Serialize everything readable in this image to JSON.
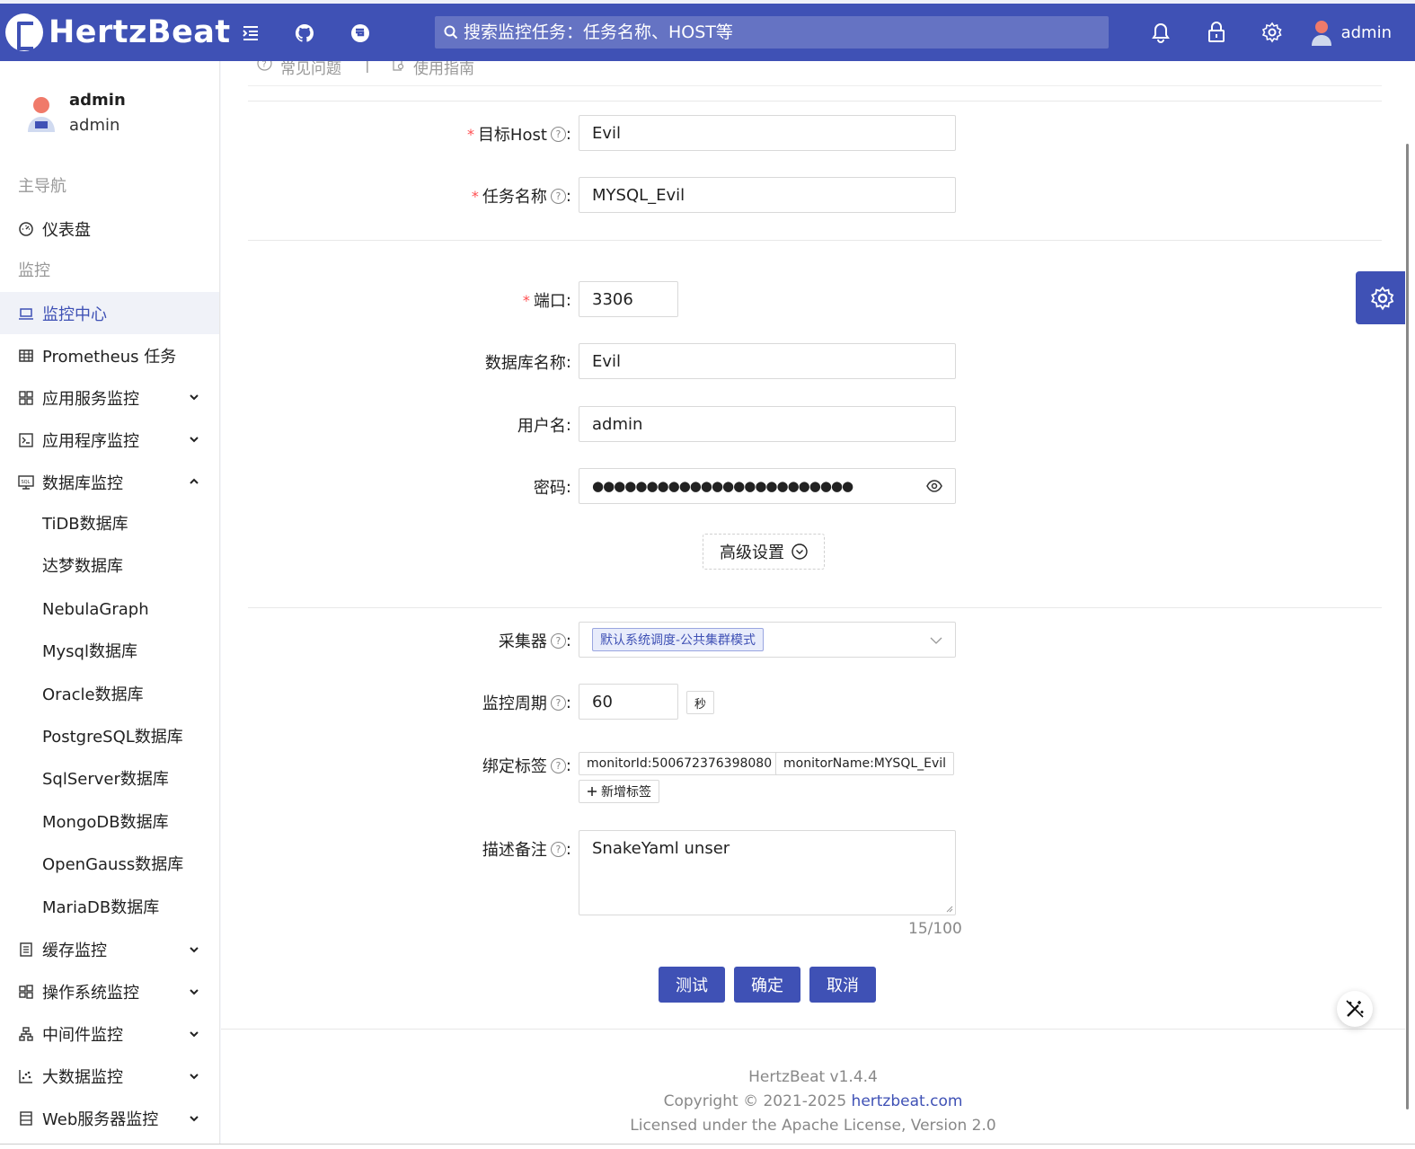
{
  "header": {
    "app_name": "HertzBeat",
    "search_placeholder": "搜索监控任务：任务名称、HOST等",
    "user": "admin"
  },
  "sidebar": {
    "user_name": "admin",
    "user_role": "admin",
    "group_main": "主导航",
    "dashboard": "仪表盘",
    "group_monitor": "监控",
    "monitor_center": "监控中心",
    "prometheus": "Prometheus 任务",
    "app_service": "应用服务监控",
    "app_program": "应用程序监控",
    "db_monitor": "数据库监控",
    "db_items": [
      "TiDB数据库",
      "达梦数据库",
      "NebulaGraph",
      "Mysql数据库",
      "Oracle数据库",
      "PostgreSQL数据库",
      "SqlServer数据库",
      "MongoDB数据库",
      "OpenGauss数据库",
      "MariaDB数据库"
    ],
    "cache": "缓存监控",
    "os": "操作系统监控",
    "middleware": "中间件监控",
    "bigdata": "大数据监控",
    "web": "Web服务器监控"
  },
  "crumb": {
    "faq": "常见问题",
    "sep": "|",
    "guide": "使用指南"
  },
  "form": {
    "host_label": "目标Host",
    "host_value": "Evil",
    "name_label": "任务名称",
    "name_value": "MYSQL_Evil",
    "port_label": "端口",
    "port_value": "3306",
    "db_label": "数据库名称",
    "db_value": "Evil",
    "user_label": "用户名",
    "user_value": "admin",
    "pwd_label": "密码",
    "pwd_value": "●●●●●●●●●●●●●●●●●●●●●●●●",
    "advanced": "高级设置",
    "collector_label": "采集器",
    "collector_value": "默认系统调度-公共集群模式",
    "interval_label": "监控周期",
    "interval_value": "60",
    "interval_unit": "秒",
    "tags_label": "绑定标签",
    "tag1": "monitorId:500672376398080",
    "tag2": "monitorName:MYSQL_Evil",
    "add_tag": "新增标签",
    "desc_label": "描述备注",
    "desc_value": "SnakeYaml unser",
    "desc_count": "15/100",
    "colon": ":",
    "btn_test": "测试",
    "btn_ok": "确定",
    "btn_cancel": "取消"
  },
  "footer": {
    "version": "HertzBeat v1.4.4",
    "copyright": "Copyright © 2021-2025",
    "link": "hertzbeat.com",
    "license": "Licensed under the Apache License, Version 2.0"
  },
  "colors": {
    "primary": "#3f51b5",
    "required": "#ff4d4f"
  }
}
